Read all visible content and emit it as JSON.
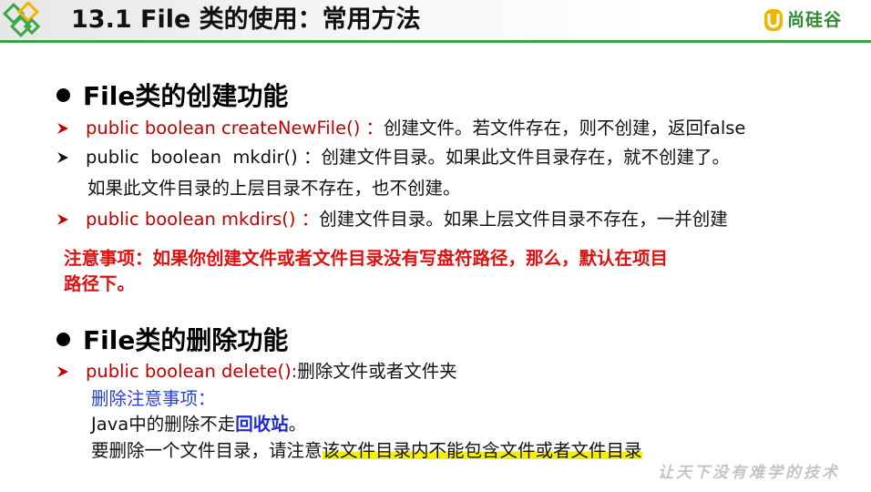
{
  "header": {
    "title": "13.1 File 类的使用：常用方法",
    "logo_text": "尚硅谷",
    "accent_color": "#37a447"
  },
  "creation": {
    "heading": "File类的创建功能",
    "items": [
      {
        "code": "public boolean createNewFile() ：",
        "desc": "创建文件。若文件存在，则不创建，返回false"
      },
      {
        "code": "public  boolean  mkdir() ：",
        "desc": "创建文件目录。如果此文件目录存在，就不创建了。"
      },
      {
        "code": "public boolean mkdirs() ：",
        "desc": "创建文件目录。如果上层文件目录不存在，一并创建"
      }
    ],
    "mkdir_continuation": "如果此文件目录的上层目录不存在，也不创建。",
    "note_line1": "注意事项：如果你创建文件或者文件目录没有写盘符路径，那么，默认在项目",
    "note_line2": "路径下。"
  },
  "deletion": {
    "heading": "File类的删除功能",
    "item_code": "public boolean delete():",
    "item_desc": "删除文件或者文件夹",
    "notes_label": "删除注意事项：",
    "line1_prefix": "Java中的删除不走",
    "line1_emphasis": "回收站",
    "line1_suffix": "。",
    "line2_prefix": "要删除一个文件目录，请注意",
    "line2_highlight": "该文件目录内不能包含文件或者文件目录"
  },
  "watermark": "让天下没有难学的技术"
}
